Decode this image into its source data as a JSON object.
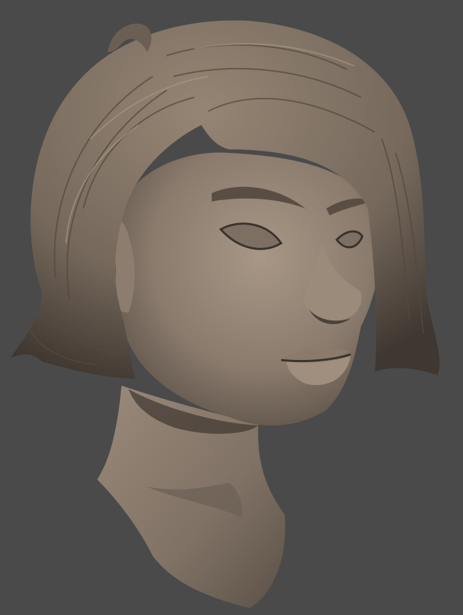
{
  "scene": {
    "background_color": "#4a4a4a",
    "material_base_color": "#8f8173",
    "material_highlight_color": "#b2a292",
    "material_shadow_color": "#2c2621",
    "subject": "sculpted-female-head-bust"
  }
}
